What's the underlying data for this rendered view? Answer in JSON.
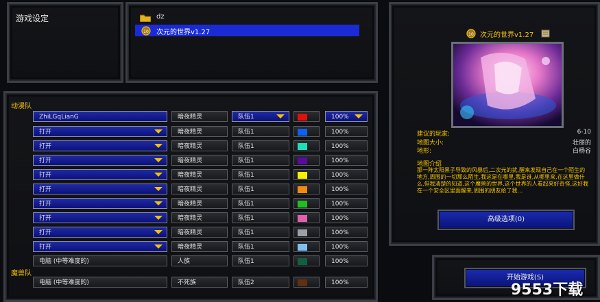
{
  "settings_panel": {
    "title": "游戏设定"
  },
  "map_list": [
    {
      "icon": "folder-icon",
      "label": "dz"
    },
    {
      "icon": "map-icon",
      "label": "次元的世界v1.27",
      "selected": true
    }
  ],
  "teams": [
    {
      "label": "动漫队"
    },
    {
      "label": "魔兽队"
    }
  ],
  "players": [
    {
      "name": "ZhiLGqLianG",
      "name_dropdown": true,
      "race": "暗夜精灵",
      "team": "队伍1",
      "team_dropdown": true,
      "color": "#e01010",
      "handicap": "100%",
      "handicap_dropdown": true
    },
    {
      "name": "打开",
      "name_dropdown": true,
      "race": "暗夜精灵",
      "team": "队伍1",
      "team_dropdown": false,
      "color": "#1060f0",
      "handicap": "100%",
      "handicap_dropdown": false
    },
    {
      "name": "打开",
      "name_dropdown": true,
      "race": "暗夜精灵",
      "team": "队伍1",
      "team_dropdown": false,
      "color": "#1ee0b8",
      "handicap": "100%",
      "handicap_dropdown": false
    },
    {
      "name": "打开",
      "name_dropdown": true,
      "race": "暗夜精灵",
      "team": "队伍1",
      "team_dropdown": false,
      "color": "#5a0aa0",
      "handicap": "100%",
      "handicap_dropdown": false
    },
    {
      "name": "打开",
      "name_dropdown": true,
      "race": "暗夜精灵",
      "team": "队伍1",
      "team_dropdown": false,
      "color": "#f8f000",
      "handicap": "100%",
      "handicap_dropdown": false
    },
    {
      "name": "打开",
      "name_dropdown": true,
      "race": "暗夜精灵",
      "team": "队伍1",
      "team_dropdown": false,
      "color": "#f08a10",
      "handicap": "100%",
      "handicap_dropdown": false
    },
    {
      "name": "打开",
      "name_dropdown": true,
      "race": "暗夜精灵",
      "team": "队伍1",
      "team_dropdown": false,
      "color": "#20c020",
      "handicap": "100%",
      "handicap_dropdown": false
    },
    {
      "name": "打开",
      "name_dropdown": true,
      "race": "暗夜精灵",
      "team": "队伍1",
      "team_dropdown": false,
      "color": "#e060b0",
      "handicap": "100%",
      "handicap_dropdown": false
    },
    {
      "name": "打开",
      "name_dropdown": true,
      "race": "暗夜精灵",
      "team": "队伍1",
      "team_dropdown": false,
      "color": "#9aa0a6",
      "handicap": "100%",
      "handicap_dropdown": false
    },
    {
      "name": "打开",
      "name_dropdown": true,
      "race": "暗夜精灵",
      "team": "队伍1",
      "team_dropdown": false,
      "color": "#80c0f0",
      "handicap": "100%",
      "handicap_dropdown": false
    },
    {
      "name": "电脑 (中等难度的)",
      "name_dropdown": false,
      "race": "人族",
      "team": "队伍1",
      "team_dropdown": false,
      "color": "#106040",
      "handicap": "100%",
      "handicap_dropdown": false
    },
    {
      "name": "电脑 (中等难度的)",
      "name_dropdown": false,
      "race": "不死族",
      "team": "队伍2",
      "team_dropdown": false,
      "color": "#603010",
      "handicap": "100%",
      "handicap_dropdown": false
    }
  ],
  "map_info": {
    "title": "次元的世界v1.27",
    "suggested_players_label": "建议的玩家:",
    "suggested_players_value": "6-10",
    "map_size_label": "地图大小:",
    "map_size_value": "壮丽的",
    "terrain_label": "地形:",
    "terrain_value": "白杨谷",
    "intro_label": "地图介绍",
    "intro_text": "那一阵太阳黑子导致的风暴后,二次元的扰,醒来发现自己在一个陌生的地方,周围的一切那么陌生,我这是在哪里,我是谁,从哪里来,在这里做什么,但我清楚的知道,这个魔兽的世界,这个世界的人看起来好奇怪,这好我在一个安全区里面醒来,周围的朋友给了我..."
  },
  "buttons": {
    "advanced": "高级选项(0)",
    "start": "开始游戏(S)"
  },
  "watermark": "9553下载"
}
